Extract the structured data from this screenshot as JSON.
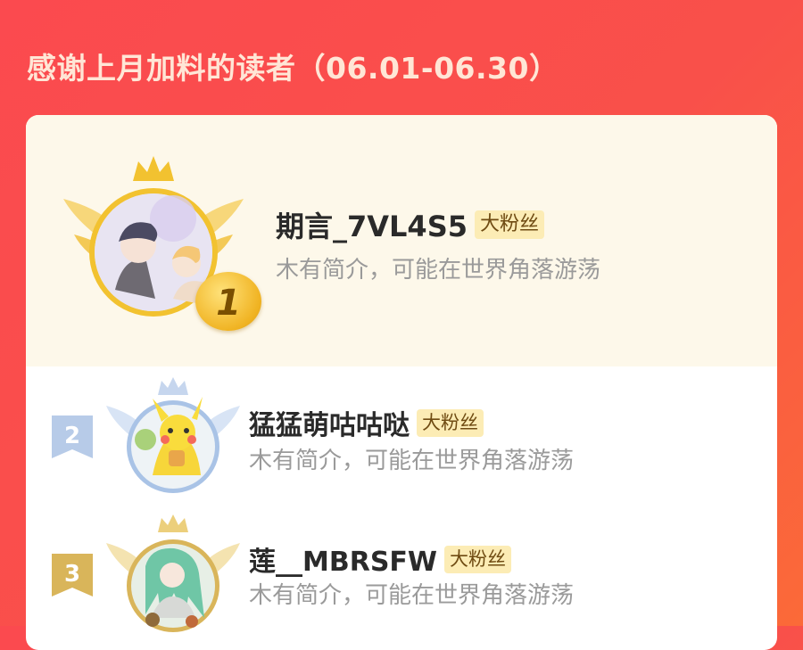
{
  "header": {
    "title": "感谢上月加料的读者（06.01-06.30）"
  },
  "colors": {
    "background_start": "#fb4a4f",
    "background_end": "#fb6a38",
    "card": "#ffffff",
    "top_highlight": "#fdf8ea",
    "gold": "#f2c230",
    "silver": "#a9c3e6",
    "bronze": "#d9b55a",
    "badge_bg": "#fcecb5"
  },
  "leaderboard": [
    {
      "rank": "1",
      "name": "期言_7VL4S5",
      "badge": "大粉丝",
      "bio": "木有简介，可能在世界角落游荡",
      "avatar_icon": "anime-couple-avatar",
      "medal": "gold-crown-wings"
    },
    {
      "rank": "2",
      "name": "猛猛萌咕咕哒",
      "badge": "大粉丝",
      "bio": "木有简介，可能在世界角落游荡",
      "avatar_icon": "pikachu-avatar",
      "medal": "silver-crown-wings"
    },
    {
      "rank": "3",
      "name": "莲__MBRSFW",
      "badge": "大粉丝",
      "bio": "木有简介，可能在世界角落游荡",
      "avatar_icon": "green-hair-anime-avatar",
      "medal": "bronze-crown-wings"
    }
  ]
}
